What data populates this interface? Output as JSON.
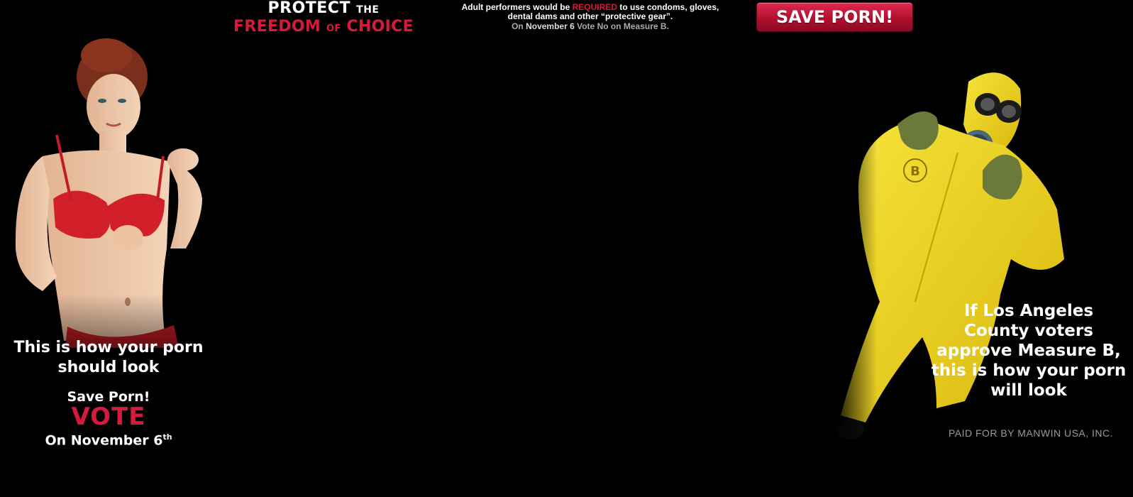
{
  "colors": {
    "background": "#000000",
    "accent": "#d61a3c",
    "text": "#ffffff",
    "muted": "#9a9a9a",
    "hazmat": "#f2d81a"
  },
  "header": {
    "headline": {
      "line1_main": "PROTECT",
      "line1_small": "THE",
      "line2_main_a": "FREEDOM",
      "line2_small": "OF",
      "line2_main_b": "CHOICE"
    },
    "notice": {
      "part1": "Adult performers would be ",
      "required": "REQUIRED",
      "part2": " to use condoms, gloves,",
      "line2": "dental dams and other “protective gear”.",
      "line3_a": "On ",
      "line3_date": "November 6",
      "line3_b": " Vote No on Measure B."
    },
    "save_button": "SAVE PORN!"
  },
  "left": {
    "image_icon": "woman-in-red-bra-photo",
    "tagline": "This is how your porn should look",
    "save": "Save Porn!",
    "vote": "VOTE",
    "date_main": "On November 6",
    "date_sup": "th"
  },
  "right": {
    "image_icon": "person-in-hazmat-suit-photo",
    "caption": "If Los Angeles County voters approve Measure B, this is how your porn will look",
    "paid_for": "PAID FOR BY MANWIN USA, INC."
  }
}
